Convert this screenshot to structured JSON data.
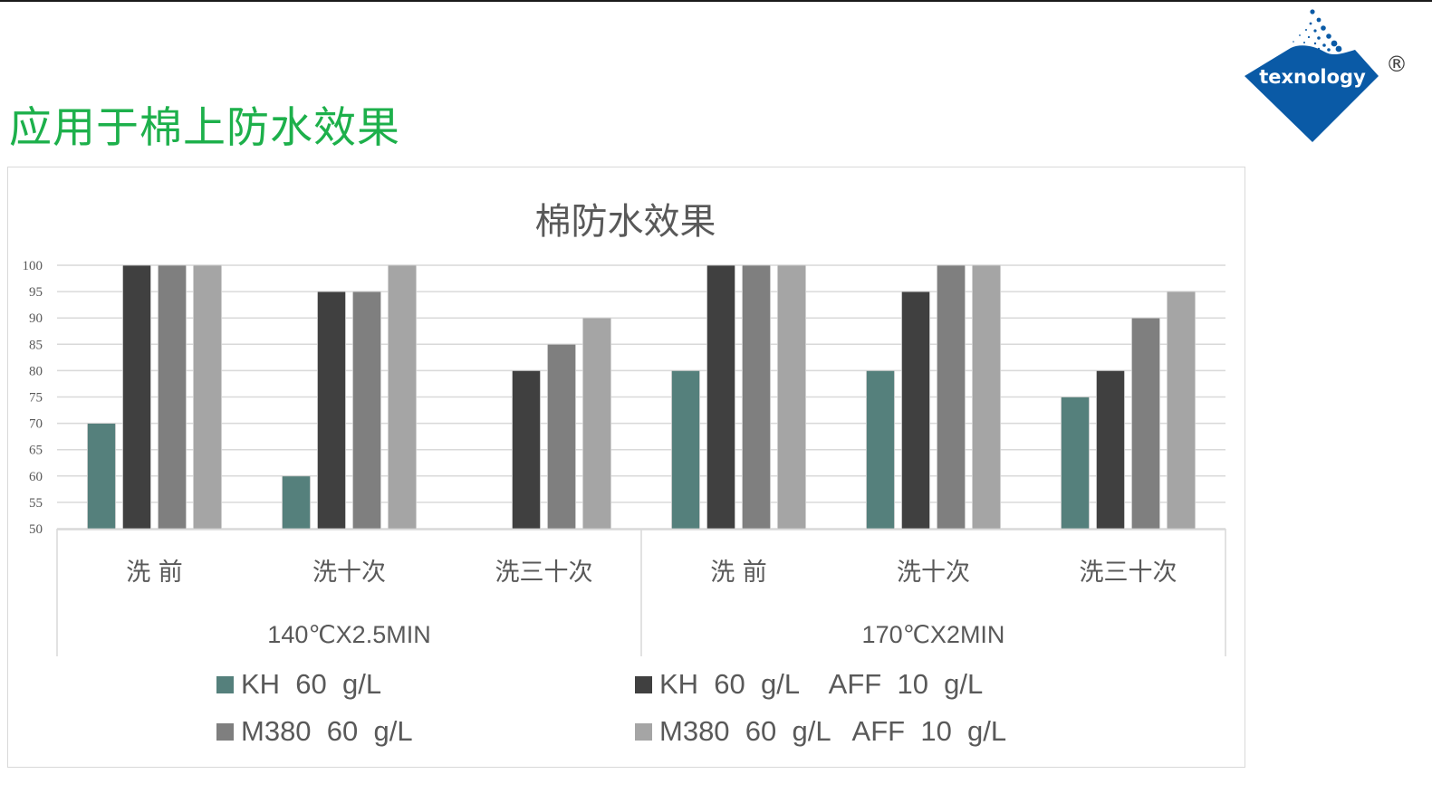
{
  "slide": {
    "title": "应用于棉上防水效果",
    "title_color": "#1db04b",
    "logo": {
      "text": "texnology",
      "registered_mark": "®",
      "brand_color": "#0a5aa6"
    }
  },
  "chart_data": {
    "type": "bar",
    "title": "棉防水效果",
    "xlabel": "",
    "ylabel": "",
    "ylim": [
      50,
      100
    ],
    "yticks": [
      100,
      95,
      90,
      85,
      80,
      75,
      70,
      65,
      60,
      55,
      50
    ],
    "grid": true,
    "legend_position": "bottom",
    "categories": [
      "洗 前",
      "洗十次",
      "洗三十次",
      "洗 前",
      "洗十次",
      "洗三十次"
    ],
    "category_groups": [
      {
        "label": "140℃X2.5MIN",
        "span": 3
      },
      {
        "label": "170℃X2MIN",
        "span": 3
      }
    ],
    "series": [
      {
        "name": "KH  60  g/L",
        "color": "#55807c",
        "values": [
          70,
          60,
          50,
          80,
          80,
          75
        ]
      },
      {
        "name": "KH  60  g/L    AFF  10  g/L",
        "color": "#404040",
        "values": [
          100,
          95,
          80,
          100,
          95,
          80
        ]
      },
      {
        "name": "M380  60  g/L",
        "color": "#7f7f7f",
        "values": [
          100,
          95,
          85,
          100,
          100,
          90
        ]
      },
      {
        "name": "M380  60  g/L   AFF  10  g/L",
        "color": "#a5a5a5",
        "values": [
          100,
          100,
          90,
          100,
          100,
          95
        ]
      }
    ]
  }
}
